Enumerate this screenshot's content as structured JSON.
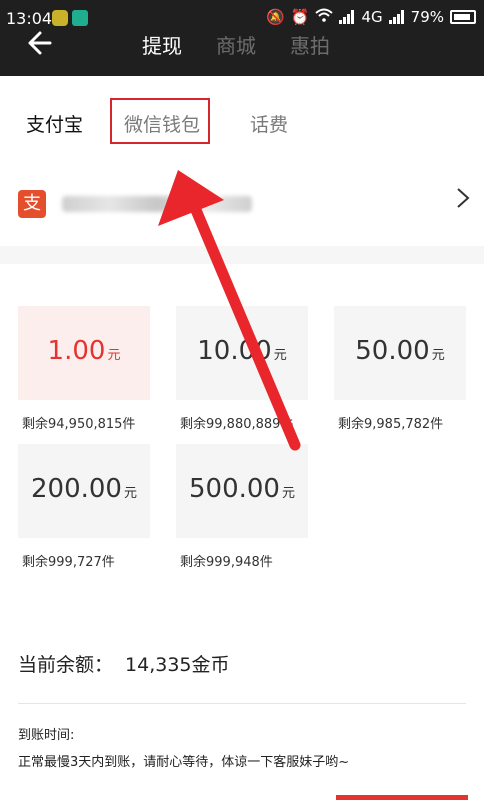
{
  "status_bar": {
    "time": "13:04",
    "network": "4G",
    "battery": "79%"
  },
  "nav": {
    "tabs": [
      {
        "label": "提现",
        "active": true
      },
      {
        "label": "商城",
        "active": false
      },
      {
        "label": "惠拍",
        "active": false
      }
    ]
  },
  "payment_tabs": [
    {
      "label": "支付宝",
      "active": true
    },
    {
      "label": "微信钱包",
      "active": false,
      "highlighted": true
    },
    {
      "label": "话费",
      "active": false
    }
  ],
  "account": {
    "icon_char": "支",
    "icon": "alipay-icon"
  },
  "amounts": [
    {
      "value": "1.00",
      "unit": "元",
      "remaining": "剩余94,950,815件",
      "selected": true
    },
    {
      "value": "10.00",
      "unit": "元",
      "remaining": "剩余99,880,889件",
      "selected": false
    },
    {
      "value": "50.00",
      "unit": "元",
      "remaining": "剩余9,985,782件",
      "selected": false
    },
    {
      "value": "200.00",
      "unit": "元",
      "remaining": "剩余999,727件",
      "selected": false
    },
    {
      "value": "500.00",
      "unit": "元",
      "remaining": "剩余999,948件",
      "selected": false
    }
  ],
  "balance": {
    "label": "当前余额：",
    "value": "14,335金币"
  },
  "arrival": {
    "title": "到账时间:",
    "text": "正常最慢3天内到账，请耐心等待，体谅一下客服妹子哟~"
  },
  "colors": {
    "accent": "#e3342f",
    "highlight_box": "#d7262b",
    "topbar": "#1f1f1f"
  }
}
